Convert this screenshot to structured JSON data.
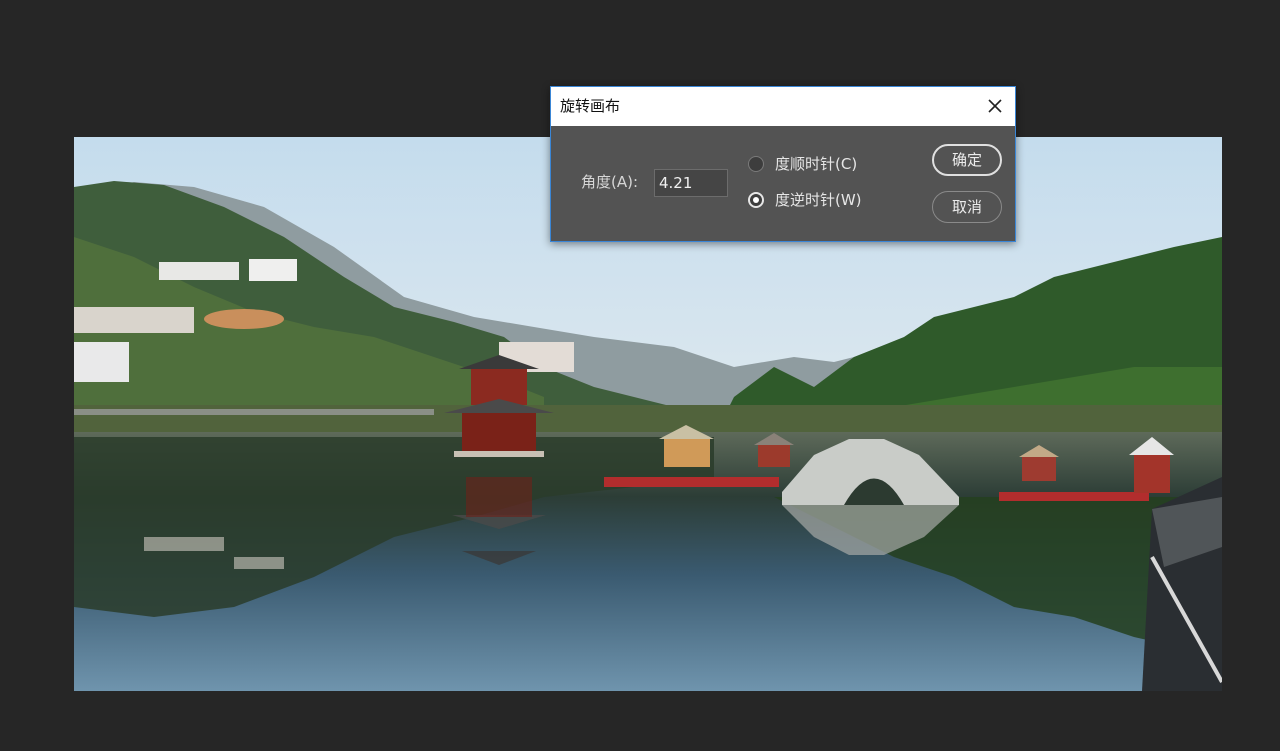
{
  "dialog": {
    "title": "旋转画布",
    "close_icon": "close-icon",
    "angle_label": "角度(A):",
    "angle_value": "4.21",
    "options": [
      {
        "label": "度顺时针(C)",
        "selected": false
      },
      {
        "label": "度逆时针(W)",
        "selected": true
      }
    ],
    "ok_label": "确定",
    "cancel_label": "取消",
    "accent_color": "#3a86d6"
  },
  "canvas": {
    "content": "landscape-photo"
  }
}
